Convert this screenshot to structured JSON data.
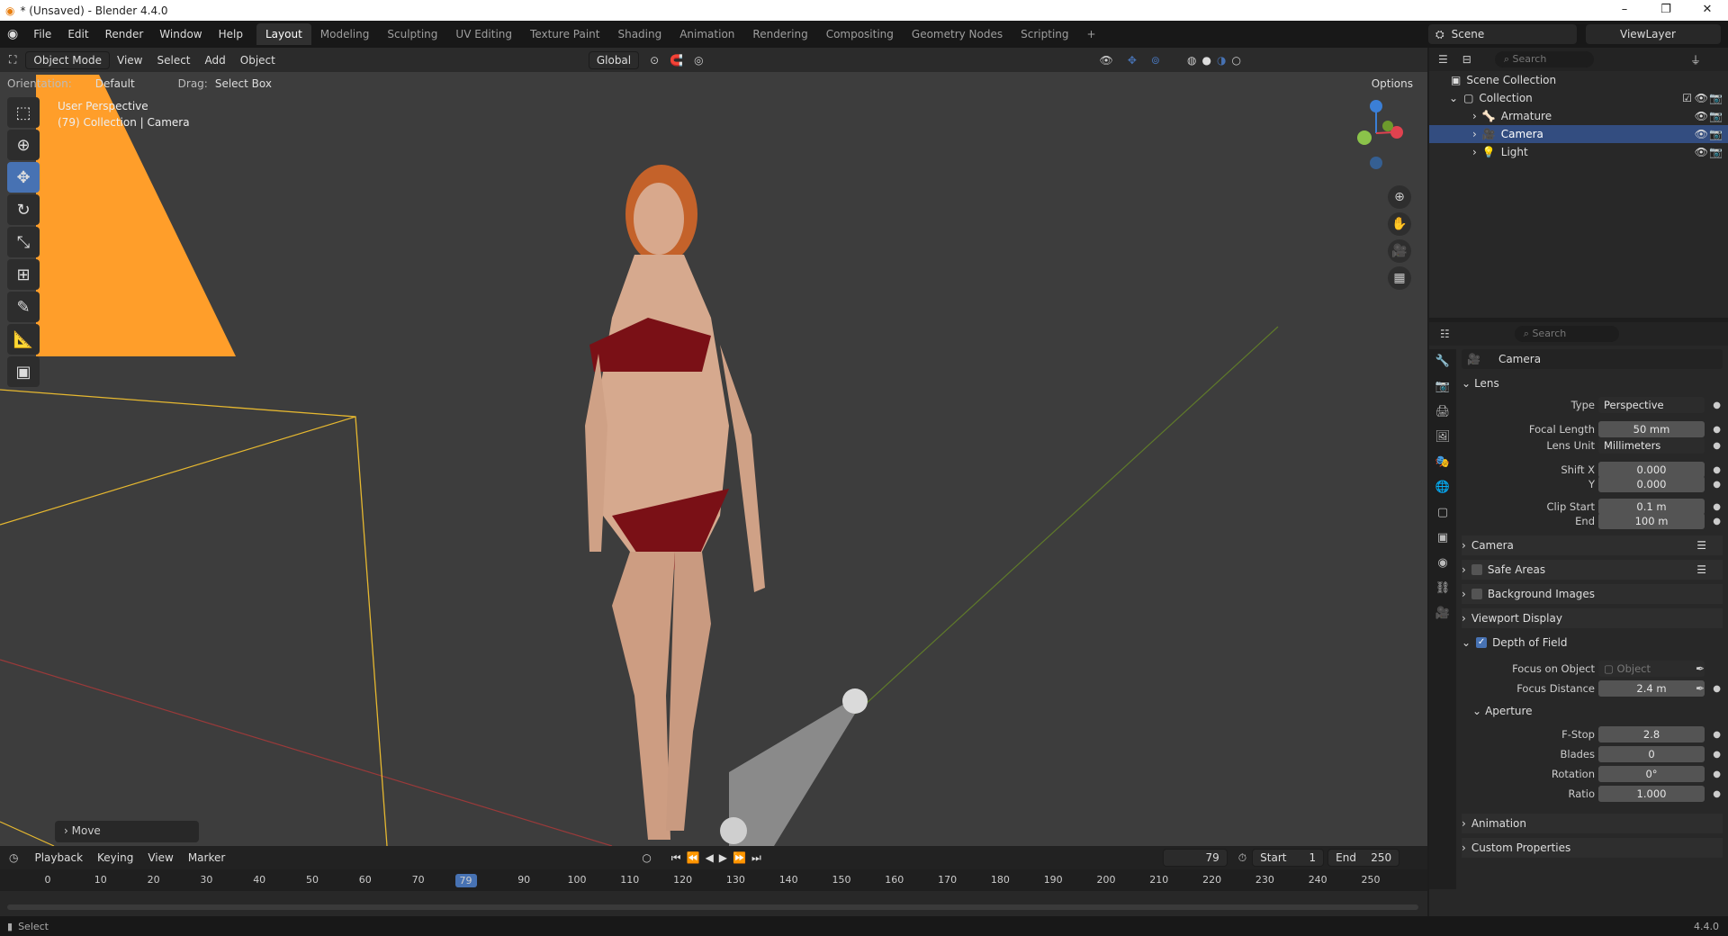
{
  "titlebar": {
    "title": "* (Unsaved) - Blender 4.4.0"
  },
  "menu": {
    "items": [
      "File",
      "Edit",
      "Render",
      "Window",
      "Help"
    ]
  },
  "workspaces": [
    "Layout",
    "Modeling",
    "Sculpting",
    "UV Editing",
    "Texture Paint",
    "Shading",
    "Animation",
    "Rendering",
    "Compositing",
    "Geometry Nodes",
    "Scripting"
  ],
  "active_workspace": "Layout",
  "scene": {
    "name": "Scene",
    "view_layer": "ViewLayer"
  },
  "viewport": {
    "mode": "Object Mode",
    "menus": [
      "View",
      "Select",
      "Add",
      "Object"
    ],
    "transform_orientation": "Global",
    "orientation_label": "Orientation:",
    "orientation_value": "Default",
    "drag_label": "Drag:",
    "drag_value": "Select Box",
    "options": "Options",
    "perspective": "User Perspective",
    "context": "(79) Collection | Camera",
    "last_operator": "Move"
  },
  "timeline": {
    "menus": [
      "Playback",
      "Keying",
      "View",
      "Marker"
    ],
    "current_frame": "79",
    "start_label": "Start",
    "start": "1",
    "end_label": "End",
    "end": "250",
    "ticks": [
      "0",
      "10",
      "20",
      "30",
      "40",
      "50",
      "60",
      "70",
      "90",
      "100",
      "110",
      "120",
      "130",
      "140",
      "150",
      "160",
      "170",
      "180",
      "190",
      "200",
      "210",
      "220",
      "230",
      "240",
      "250"
    ]
  },
  "statusbar": {
    "left": "Select",
    "version": "4.4.0"
  },
  "outliner": {
    "search": "Search",
    "root": "Scene Collection",
    "collection": "Collection",
    "items": [
      "Armature",
      "Camera",
      "Light"
    ]
  },
  "properties": {
    "search": "Search",
    "object": "Camera",
    "lens": {
      "title": "Lens",
      "type_label": "Type",
      "type": "Perspective",
      "focal_label": "Focal Length",
      "focal": "50 mm",
      "unit_label": "Lens Unit",
      "unit": "Millimeters",
      "shiftx_label": "Shift X",
      "shiftx": "0.000",
      "shifty_label": "Y",
      "shifty": "0.000",
      "clipstart_label": "Clip Start",
      "clipstart": "0.1 m",
      "clipend_label": "End",
      "clipend": "100 m"
    },
    "sections": {
      "camera": "Camera",
      "safe_areas": "Safe Areas",
      "background_images": "Background Images",
      "viewport_display": "Viewport Display",
      "dof": "Depth of Field",
      "animation": "Animation",
      "custom_props": "Custom Properties"
    },
    "dof": {
      "focus_obj_label": "Focus on Object",
      "focus_obj_placeholder": "Object",
      "focus_dist_label": "Focus Distance",
      "focus_dist": "2.4 m",
      "aperture": "Aperture",
      "fstop_label": "F-Stop",
      "fstop": "2.8",
      "blades_label": "Blades",
      "blades": "0",
      "rotation_label": "Rotation",
      "rotation": "0°",
      "ratio_label": "Ratio",
      "ratio": "1.000"
    }
  },
  "colors": {
    "accent": "#4772b3",
    "selection": "#334d80",
    "camera_orange": "#ff9e2a"
  }
}
